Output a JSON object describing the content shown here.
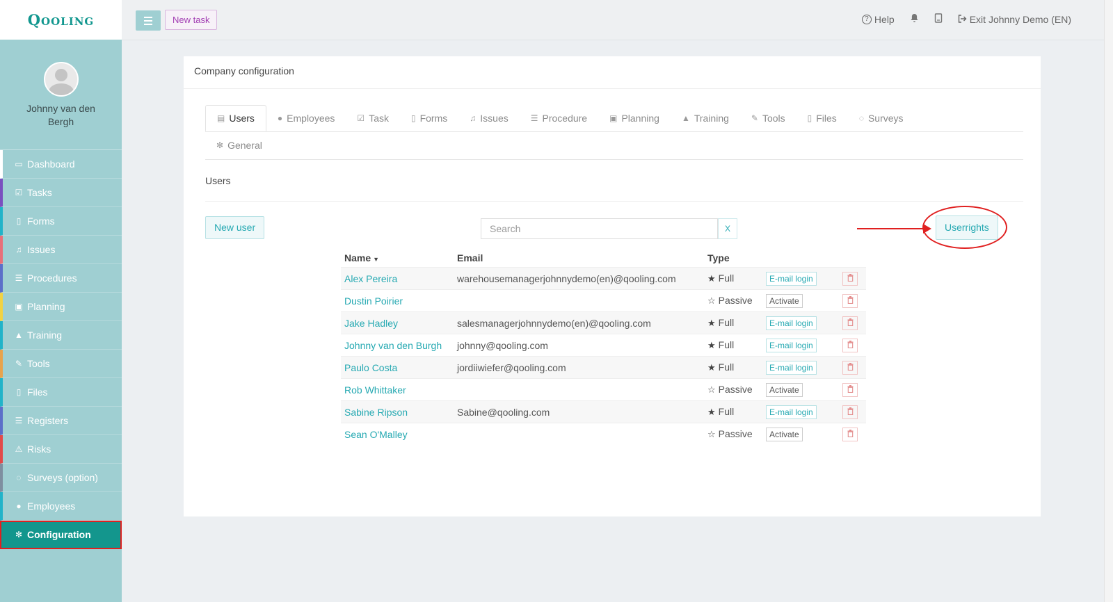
{
  "app": {
    "brand": "Qooling",
    "user_name": "Johnny van den Bergh"
  },
  "sidebar": {
    "items": [
      {
        "label": "Dashboard",
        "icon": "monitor-icon",
        "color": "#ffffff"
      },
      {
        "label": "Tasks",
        "icon": "check-icon",
        "color": "#7a4fbf"
      },
      {
        "label": "Forms",
        "icon": "file-icon",
        "color": "#21b3c9"
      },
      {
        "label": "Issues",
        "icon": "bell-icon",
        "color": "#e8707a"
      },
      {
        "label": "Procedures",
        "icon": "list-icon",
        "color": "#5c6fc9"
      },
      {
        "label": "Planning",
        "icon": "calendar-icon",
        "color": "#f1d243"
      },
      {
        "label": "Training",
        "icon": "graduation-cap-icon",
        "color": "#21b3c9"
      },
      {
        "label": "Tools",
        "icon": "wrench-icon",
        "color": "#e8a34c"
      },
      {
        "label": "Files",
        "icon": "file-icon",
        "color": "#21b3c9"
      },
      {
        "label": "Registers",
        "icon": "list-icon",
        "color": "#5c6fc9"
      },
      {
        "label": "Risks",
        "icon": "warning-icon",
        "color": "#e24a4a"
      },
      {
        "label": "Surveys (option)",
        "icon": "comment-icon",
        "color": "#7e8fa0"
      },
      {
        "label": "Employees",
        "icon": "users-icon",
        "color": "#21b3c9"
      },
      {
        "label": "Configuration",
        "icon": "gear-icon",
        "color": "#13968d",
        "active": true
      }
    ]
  },
  "topbar": {
    "new_task": "New task",
    "help": "Help",
    "exit": "Exit Johnny Demo (EN)"
  },
  "panel": {
    "title": "Company configuration",
    "tabs_row1": [
      {
        "label": "Users",
        "icon": "id-card-icon",
        "active": true
      },
      {
        "label": "Employees",
        "icon": "users-icon"
      },
      {
        "label": "Task",
        "icon": "check-icon"
      },
      {
        "label": "Forms",
        "icon": "file-icon"
      },
      {
        "label": "Issues",
        "icon": "bell-icon"
      },
      {
        "label": "Procedure",
        "icon": "list-icon"
      },
      {
        "label": "Planning",
        "icon": "calendar-icon"
      },
      {
        "label": "Training",
        "icon": "graduation-cap-icon"
      },
      {
        "label": "Tools",
        "icon": "wrench-icon"
      },
      {
        "label": "Files",
        "icon": "file-icon"
      },
      {
        "label": "Surveys",
        "icon": "comment-icon"
      }
    ],
    "tabs_row2": [
      {
        "label": "General",
        "icon": "gear-icon"
      }
    ],
    "section_title": "Users",
    "new_user": "New user",
    "search_placeholder": "Search",
    "search_clear": "X",
    "userrights": "Userrights"
  },
  "table": {
    "headers": {
      "name": "Name",
      "email": "Email",
      "type": "Type"
    },
    "rows": [
      {
        "name": "Alex Pereira",
        "email": "warehousemanagerjohnnydemo(en)@qooling.com",
        "type": "Full",
        "action": "E-mail login"
      },
      {
        "name": "Dustin Poirier",
        "email": "",
        "type": "Passive",
        "action": "Activate"
      },
      {
        "name": "Jake Hadley",
        "email": "salesmanagerjohnnydemo(en)@qooling.com",
        "type": "Full",
        "action": "E-mail login"
      },
      {
        "name": "Johnny van den Burgh",
        "email": "johnny@qooling.com",
        "type": "Full",
        "action": "E-mail login"
      },
      {
        "name": "Paulo Costa",
        "email": "jordiiwiefer@qooling.com",
        "type": "Full",
        "action": "E-mail login"
      },
      {
        "name": "Rob Whittaker",
        "email": "",
        "type": "Passive",
        "action": "Activate"
      },
      {
        "name": "Sabine Ripson",
        "email": "Sabine@qooling.com",
        "type": "Full",
        "action": "E-mail login"
      },
      {
        "name": "Sean O'Malley",
        "email": "",
        "type": "Passive",
        "action": "Activate"
      }
    ]
  }
}
